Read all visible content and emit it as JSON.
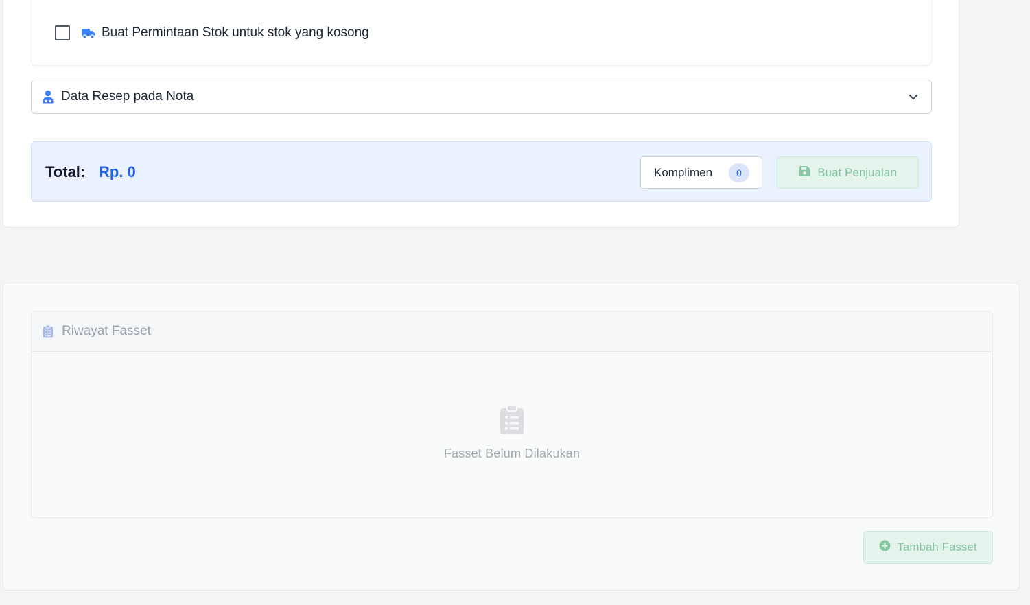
{
  "stock_request": {
    "checkbox_checked": false,
    "label": "Buat Permintaan Stok untuk stok yang kosong",
    "icon": "truck-icon"
  },
  "prescription_accordion": {
    "label": "Data Resep pada Nota",
    "icon": "doctor-icon",
    "expanded": false
  },
  "summary": {
    "total_label": "Total:",
    "total_value": "Rp. 0",
    "komplimen_label": "Komplimen",
    "komplimen_count": "0",
    "save_label": "Buat Penjualan",
    "save_icon": "floppy-disk-icon"
  },
  "fasset_history": {
    "title": "Riwayat Fasset",
    "icon": "clipboard-list-icon",
    "empty_text": "Fasset Belum Dilakukan",
    "add_label": "Tambah Fasset",
    "add_icon": "plus-circle-icon"
  },
  "colors": {
    "accent_blue": "#2563eb",
    "success_disabled_text": "#86c6a0",
    "success_disabled_bg": "#e4f3ec",
    "total_bar_bg": "#eaf2ff"
  }
}
